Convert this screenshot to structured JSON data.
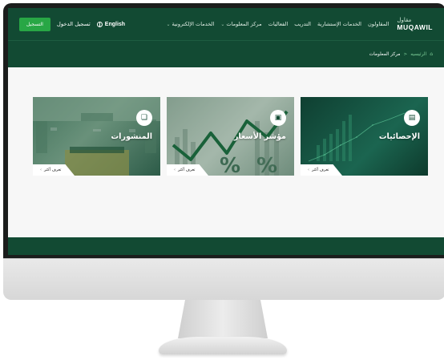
{
  "header": {
    "logo_ar": "مقاول",
    "logo_en": "MUQAWIL",
    "nav": [
      {
        "label": "المقاولون",
        "has_menu": false
      },
      {
        "label": "الخدمات الإستشارية",
        "has_menu": false
      },
      {
        "label": "التدريب",
        "has_menu": false
      },
      {
        "label": "الفعاليات",
        "has_menu": false
      },
      {
        "label": "مركز المعلومات",
        "has_menu": true
      },
      {
        "label": "الخدمات الإلكترونية",
        "has_menu": true
      }
    ],
    "language": "English",
    "login": "تسجيل الدخول",
    "register": "التسجيل"
  },
  "breadcrumb": {
    "home": "الرئيسيه",
    "separator": "<",
    "current": "مركز المعلومات"
  },
  "cards": [
    {
      "title": "الإحصائيات",
      "learn_more": "تعرف أكثر",
      "icon": "document-chart-icon"
    },
    {
      "title": "مؤشر الأسعار",
      "learn_more": "تعرف أكثر",
      "icon": "price-tag-icon"
    },
    {
      "title": "المنشورات",
      "learn_more": "تعرف أكثر",
      "icon": "publication-icon"
    }
  ],
  "colors": {
    "brand_dark_green": "#124a33",
    "register_green": "#28a745",
    "accent_light_green": "#7fd09a"
  }
}
